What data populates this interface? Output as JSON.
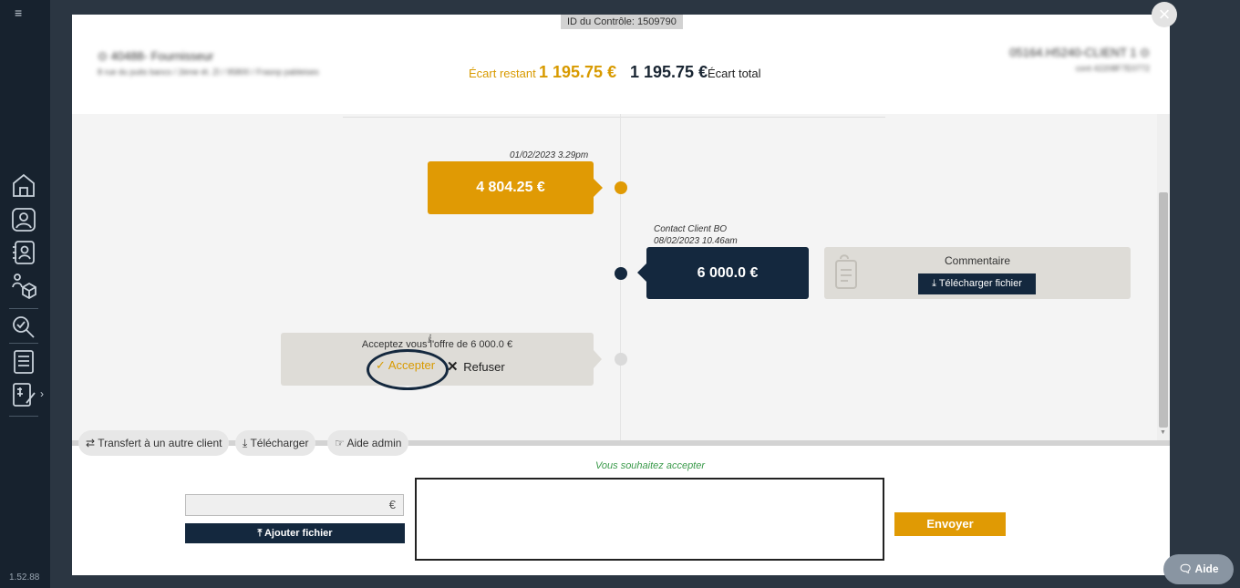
{
  "app": {
    "version": "1.52.88"
  },
  "header": {
    "control_id": "ID du Contrôle: 1509790",
    "supplier_name": "⊙ 40488- Fournisseur",
    "supplier_address": "8 rue du puits bancs / 2ème ét. ZI / 95800 / Frasnp pableises",
    "client_name": "05164.H5240-CLIENT 1 ⊙",
    "client_sub": "cont 42208F7E0772",
    "ecart_restant_label": "Écart restant",
    "ecart_restant_value": "1 195.75 €",
    "ecart_total_value": "1 195.75 €",
    "ecart_total_label": "Écart total"
  },
  "timeline": {
    "event1": {
      "timestamp": "01/02/2023 3.29pm",
      "amount": "4 804.25 €"
    },
    "event2": {
      "author": "Contact Client BO",
      "timestamp": "08/02/2023 10.46am",
      "amount": "6 000.0 €"
    },
    "comment": {
      "label": "Commentaire",
      "download_label": "Télécharger fichier"
    },
    "offer": {
      "prompt": "Acceptez vous l'offre de 6 000.0 €",
      "accept_label": "Accepter",
      "refuse_label": "Refuser"
    }
  },
  "actions": {
    "transfer_label": "Transfert à un autre client",
    "download_label": "Télécharger",
    "admin_help_label": "Aide admin"
  },
  "reply": {
    "accept_message": "Vous souhaitez accepter",
    "currency": "€",
    "add_file_label": "Ajouter fichier",
    "send_label": "Envoyer"
  },
  "help": {
    "label": "Aide"
  },
  "colors": {
    "accent": "#e09a04",
    "navy": "#14283e",
    "success_text": "#3a9a4a"
  }
}
